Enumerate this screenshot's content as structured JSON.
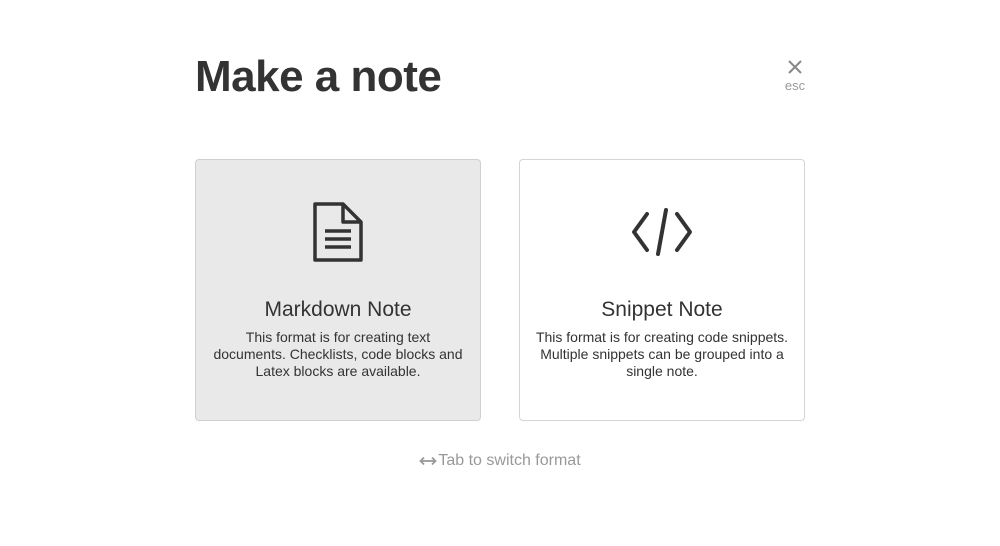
{
  "dialog": {
    "title": "Make a note",
    "close": {
      "label": "esc",
      "icon": "close-icon"
    }
  },
  "cards": [
    {
      "title": "Markdown Note",
      "description": "This format is for creating text documents. Checklists, code blocks and Latex blocks are available.",
      "icon": "document-icon",
      "selected": true
    },
    {
      "title": "Snippet Note",
      "description": "This format is for creating code snippets. Multiple snippets can be grouped into a single note.",
      "icon": "code-icon",
      "selected": false
    }
  ],
  "hint": {
    "text": "Tab to switch format",
    "icon": "horizontal-arrows-icon"
  },
  "colors": {
    "text": "#333333",
    "muted": "#999999",
    "selected_card_bg": "#e9e9e9",
    "card_border": "#d5d5d5"
  }
}
